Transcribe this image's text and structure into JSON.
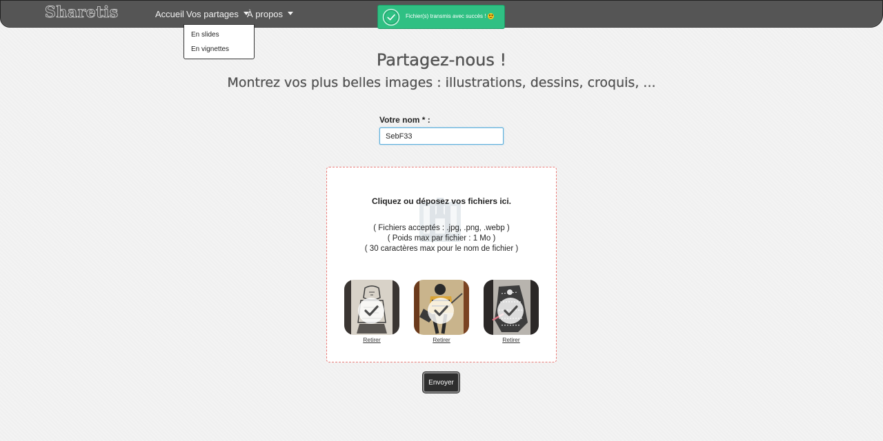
{
  "navbar": {
    "brand": "Sharetis",
    "links": {
      "home": "Accueil",
      "shares": "Vos partages",
      "about": "À propos"
    },
    "dropdown": {
      "items": [
        "En slides",
        "En vignettes"
      ]
    }
  },
  "toast": {
    "message": "Fichier(s) transmis avec succès !",
    "icon": "check-circle-icon",
    "emoji": "smiley-icon",
    "color": "#2fc083"
  },
  "main": {
    "title": "Partagez-nous !",
    "subtitle": "Montrez vos plus belles images : illustrations, dessins, croquis, ..."
  },
  "form": {
    "name_label": "Votre nom * :",
    "name_value": "SebF33"
  },
  "dropzone": {
    "main_text": "Cliquez ou déposez vos fichiers ici.",
    "info": [
      "( Fichiers acceptés : .jpg, .png, .webp )",
      "( Poids max par fichier : 1 Mo )",
      "( 30 caractères max pour le nom de fichier )"
    ],
    "border_color": "#e97a76",
    "files": [
      {
        "remove_label": "Retirer"
      },
      {
        "remove_label": "Retirer"
      },
      {
        "remove_label": "Retirer"
      }
    ]
  },
  "submit": {
    "label": "Envoyer"
  }
}
